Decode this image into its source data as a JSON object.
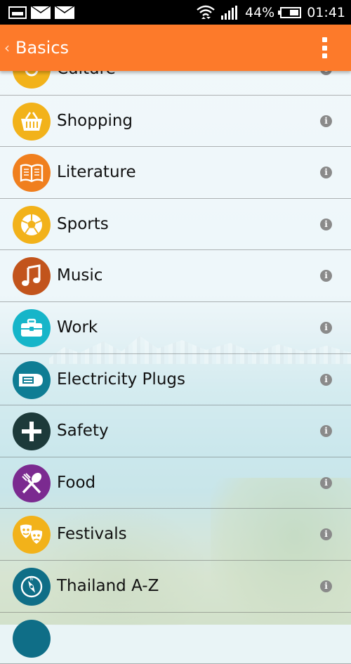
{
  "status_bar": {
    "battery_percent": "44%",
    "time": "01:41"
  },
  "action_bar": {
    "title": "Basics"
  },
  "colors": {
    "action_bar": "#fd7a2a"
  },
  "list": {
    "items": [
      {
        "label": "Culture",
        "icon": "culture-icon",
        "color": "#f2b21a"
      },
      {
        "label": "Shopping",
        "icon": "shopping-basket-icon",
        "color": "#f2b21a"
      },
      {
        "label": "Literature",
        "icon": "book-icon",
        "color": "#f07f1e"
      },
      {
        "label": "Sports",
        "icon": "soccer-ball-icon",
        "color": "#f2b21a"
      },
      {
        "label": "Music",
        "icon": "music-note-icon",
        "color": "#c2541c"
      },
      {
        "label": "Work",
        "icon": "briefcase-icon",
        "color": "#16b5c9"
      },
      {
        "label": "Electricity Plugs",
        "icon": "plug-icon",
        "color": "#0f7d94"
      },
      {
        "label": "Safety",
        "icon": "plus-icon",
        "color": "#1d3a3a"
      },
      {
        "label": "Food",
        "icon": "fork-spoon-icon",
        "color": "#7b2a90"
      },
      {
        "label": "Festivals",
        "icon": "theater-masks-icon",
        "color": "#f2b21a"
      },
      {
        "label": "Thailand A-Z",
        "icon": "compass-icon",
        "color": "#0f6e87"
      },
      {
        "label": "",
        "icon": "partial-icon",
        "color": "#0f6e87"
      }
    ]
  }
}
